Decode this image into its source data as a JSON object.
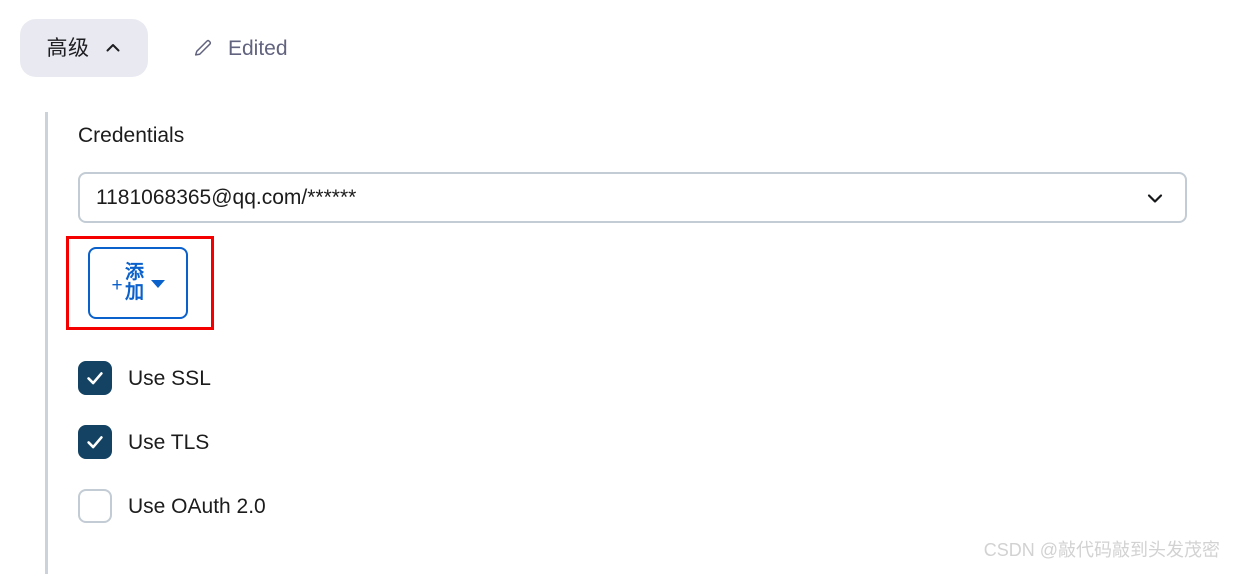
{
  "header": {
    "advanced_button": {
      "label": "高级",
      "chevron_icon": "chevron-up-icon"
    },
    "edited_status": {
      "icon": "pencil-icon",
      "label": "Edited"
    }
  },
  "section": {
    "title": "Credentials",
    "credentials_combo": {
      "value": "1181068365@qq.com/******",
      "chevron_icon": "chevron-down-icon"
    },
    "add_button": {
      "plus_icon": "plus-icon",
      "label": "添加",
      "caret_icon": "caret-down-icon",
      "accent_color": "#0b61cc"
    },
    "highlight": {
      "type": "annotation-rectangle",
      "color": "#f50000"
    },
    "checkboxes": [
      {
        "label": "Use SSL",
        "checked": true
      },
      {
        "label": "Use TLS",
        "checked": true
      },
      {
        "label": "Use OAuth 2.0",
        "checked": false
      }
    ],
    "checked_color": "#134263",
    "unchecked_border_color": "#c3ccd4"
  },
  "watermark": {
    "text": "CSDN @敲代码敲到头发茂密"
  }
}
